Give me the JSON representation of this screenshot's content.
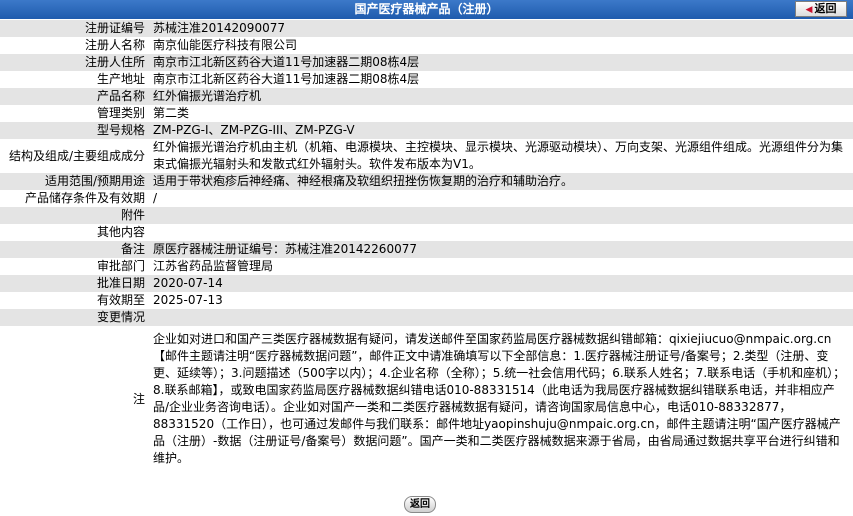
{
  "header": {
    "title": "国产医疗器械产品（注册）",
    "back_label": "返回"
  },
  "rows": [
    {
      "label": "注册证编号",
      "value": "苏械注准20142090077"
    },
    {
      "label": "注册人名称",
      "value": "南京仙能医疗科技有限公司"
    },
    {
      "label": "注册人住所",
      "value": "南京市江北新区药谷大道11号加速器二期08栋4层"
    },
    {
      "label": "生产地址",
      "value": "南京市江北新区药谷大道11号加速器二期08栋4层"
    },
    {
      "label": "产品名称",
      "value": "红外偏振光谱治疗机"
    },
    {
      "label": "管理类别",
      "value": "第二类"
    },
    {
      "label": "型号规格",
      "value": "ZM-PZG-I、ZM-PZG-III、ZM-PZG-V"
    },
    {
      "label": "结构及组成/主要组成成分",
      "value": "红外偏振光谱治疗机由主机（机箱、电源模块、主控模块、显示模块、光源驱动模块）、万向支架、光源组件组成。光源组件分为集束式偏振光辐射头和发散式红外辐射头。软件发布版本为V1。"
    },
    {
      "label": "适用范围/预期用途",
      "value": "适用于带状疱疹后神经痛、神经根痛及软组织扭挫伤恢复期的治疗和辅助治疗。"
    },
    {
      "label": "产品储存条件及有效期",
      "value": "/"
    },
    {
      "label": "附件",
      "value": ""
    },
    {
      "label": "其他内容",
      "value": ""
    },
    {
      "label": "备注",
      "value": "原医疗器械注册证编号：苏械注准20142260077"
    },
    {
      "label": "审批部门",
      "value": "江苏省药品监督管理局"
    },
    {
      "label": "批准日期",
      "value": "2020-07-14"
    },
    {
      "label": "有效期至",
      "value": "2025-07-13"
    },
    {
      "label": "变更情况",
      "value": ""
    }
  ],
  "note": {
    "label": "注",
    "text": "企业如对进口和国产三类医疗器械数据有疑问，请发送邮件至国家药监局医疗器械数据纠错邮箱：qixiejiucuo@nmpaic.org.cn【邮件主题请注明“医疗器械数据问题”，邮件正文中请准确填写以下全部信息：1.医疗器械注册证号/备案号；2.类型（注册、变更、延续等）；3.问题描述（500字以内）；4.企业名称（全称）；5.统一社会信用代码；6.联系人姓名；7.联系电话（手机和座机）；8.联系邮箱】，或致电国家药监局医疗器械数据纠错电话010-88331514（此电话为我局医疗器械数据纠错联系电话，并非相应产品/企业业务咨询电话）。企业如对国产一类和二类医疗器械数据有疑问，请咨询国家局信息中心，电话010-88332877，88331520（工作日），也可通过发邮件与我们联系：邮件地址yaopinshuju@nmpaic.org.cn，邮件主题请注明“国产医疗器械产品（注册）-数据（注册证号/备案号）数据问题”。国产一类和二类医疗器械数据来源于省局，由省局通过数据共享平台进行纠错和维护。"
  },
  "footer": {
    "back_label": "返回"
  }
}
